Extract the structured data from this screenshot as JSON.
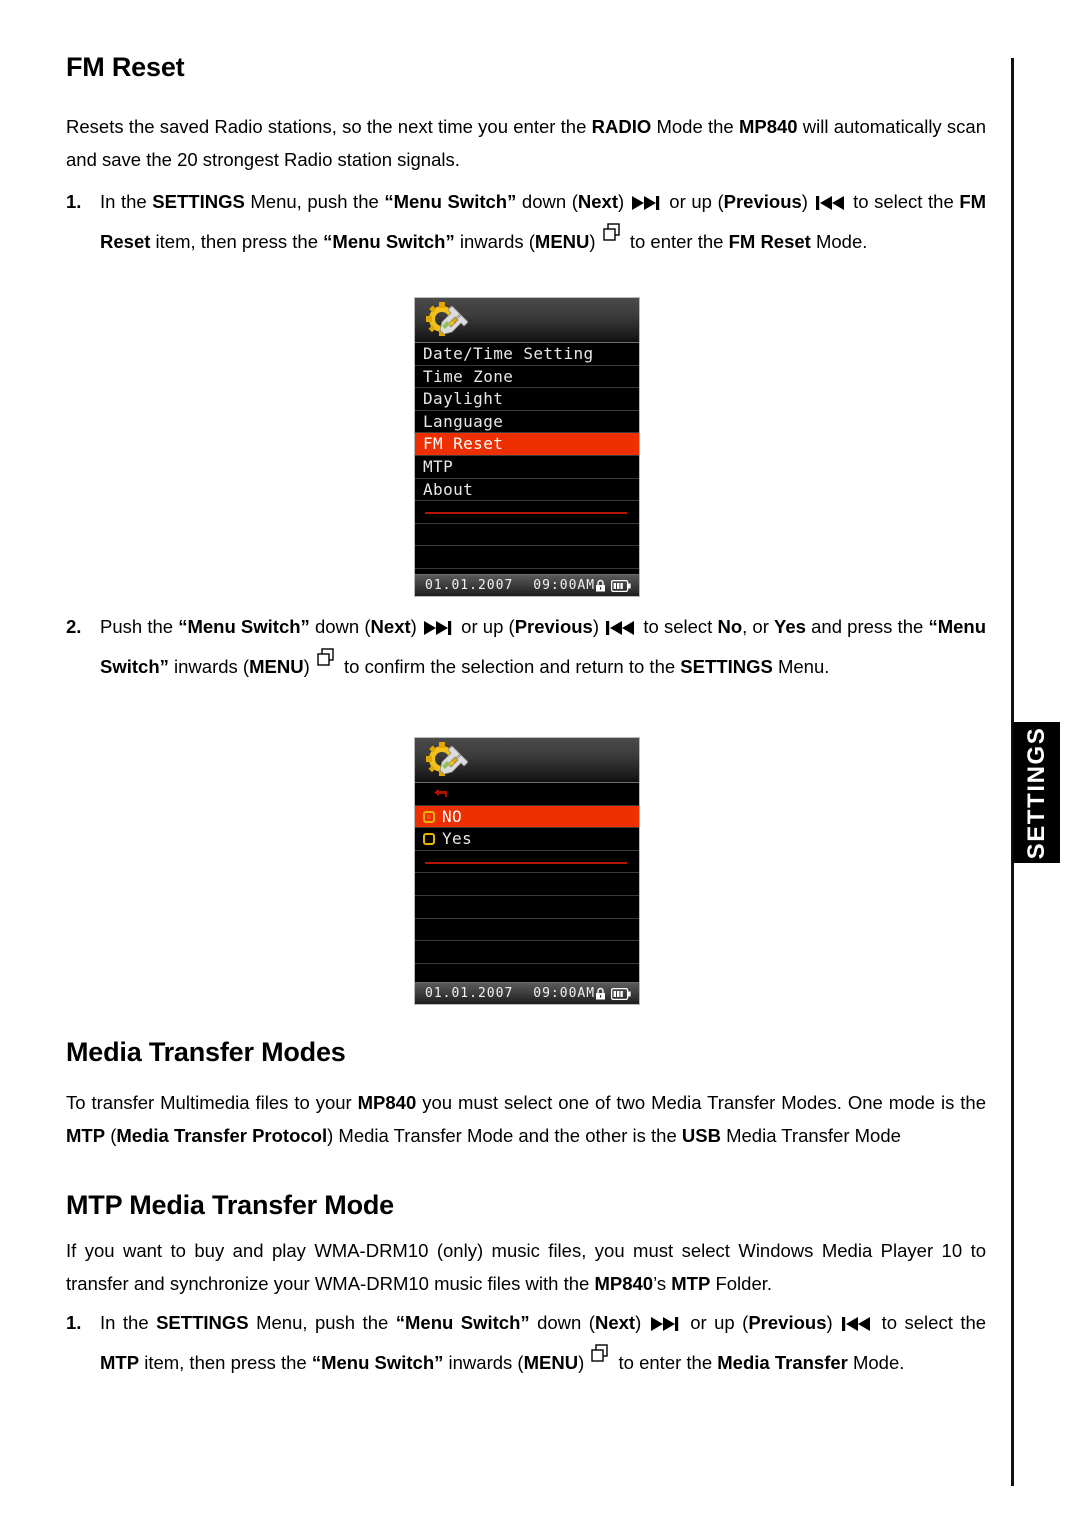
{
  "side_tab": {
    "label": "SETTINGS"
  },
  "sections": {
    "fm_reset": {
      "heading": "FM Reset",
      "intro_1": "Resets the saved Radio stations, so the next time you enter the ",
      "intro_radio": "RADIO",
      "intro_2": " Mode the ",
      "intro_mp840": "MP840",
      "intro_3": " will automatically scan and save the 20 strongest Radio station signals.",
      "step1": {
        "num": "1.",
        "t1": "In the ",
        "settings": "SETTINGS",
        "t2": " Menu, push the ",
        "menu_switch_1": "“Menu Switch”",
        "t3": " down (",
        "next": "Next",
        "t4": ")",
        "t5": " or up (",
        "previous": "Previous",
        "t6": ")",
        "t7": " to select the ",
        "item": "FM Reset",
        "t8": " item, then press the ",
        "menu_switch_2": "“Menu Switch”",
        "t9": " inwards (",
        "menu": "MENU",
        "t10": ")",
        "t11": " to enter the ",
        "mode": "FM Reset",
        "t12": " Mode."
      },
      "step2": {
        "num": "2.",
        "t1": "Push the ",
        "menu_switch_1": "“Menu Switch”",
        "t2": " down (",
        "next": "Next",
        "t3": ")",
        "t4": " or up (",
        "previous": "Previous",
        "t5": ")",
        "t6": " to select ",
        "no": "No",
        "t7": ", or ",
        "yes": "Yes",
        "t8": " and press the ",
        "menu_switch_2": "“Menu Switch”",
        "t9": " inwards (",
        "menu": "MENU",
        "t10": ")",
        "t11": " to confirm the selection and return to the ",
        "settings": "SETTINGS",
        "t12": " Menu."
      }
    },
    "media_transfer_modes": {
      "heading": "Media Transfer Modes",
      "p1a": "To transfer Multimedia files to your ",
      "p1_mp840": "MP840",
      "p1b": " you must select one of two Media Transfer Modes. One mode is the ",
      "p1_mtp": "MTP",
      "p1c": " (",
      "p1_protocol": "Media Transfer Protocol",
      "p1d": ") Media Transfer Mode and the other is the ",
      "p1_usb": "USB",
      "p1e": " Media Transfer Mode"
    },
    "mtp_mode": {
      "heading": "MTP Media Transfer Mode",
      "p1a": "If you want to buy and play WMA-DRM10 (only) music files, you must select Windows Media Player 10 to transfer and synchronize your WMA-DRM10 music files with the ",
      "p1_mp840": "MP840",
      "p1b": "’s ",
      "p1_mtp": "MTP",
      "p1c": " Folder.",
      "step1": {
        "num": "1.",
        "t1": "In the ",
        "settings": "SETTINGS",
        "t2": " Menu, push the ",
        "menu_switch_1": "“Menu Switch”",
        "t3": " down (",
        "next": "Next",
        "t4": ")",
        "t5": " or up (",
        "previous": "Previous",
        "t6": ")",
        "t7": " to select the ",
        "item": "MTP",
        "t8": " item, then press the ",
        "menu_switch_2": "“Menu Switch”",
        "t9": " inwards (",
        "menu": "MENU",
        "t10": ")",
        "t11": " to enter the ",
        "mode": "Media Transfer",
        "t12": " Mode."
      }
    }
  },
  "device_screen_1": {
    "menu_items": [
      "Date/Time Setting",
      "Time Zone",
      "Daylight",
      "Language",
      "FM Reset",
      "MTP",
      "About"
    ],
    "selected_item": "FM Reset",
    "selected_index": 4,
    "highlight_color": "#ee2f00",
    "status": {
      "date": "01.01.2007",
      "time": "09:00AM",
      "lock_icon": "lock-icon",
      "battery_icon": "battery-icon"
    },
    "header_icon": "gear-wrench-icon"
  },
  "device_screen_2": {
    "back_item": "back-arrow-icon",
    "options": [
      {
        "label": "NO",
        "selected": true
      },
      {
        "label": "Yes",
        "selected": false
      }
    ],
    "highlight_color": "#ee2f00",
    "status": {
      "date": "01.01.2007",
      "time": "09:00AM",
      "lock_icon": "lock-icon",
      "battery_icon": "battery-icon"
    },
    "header_icon": "gear-wrench-icon"
  }
}
